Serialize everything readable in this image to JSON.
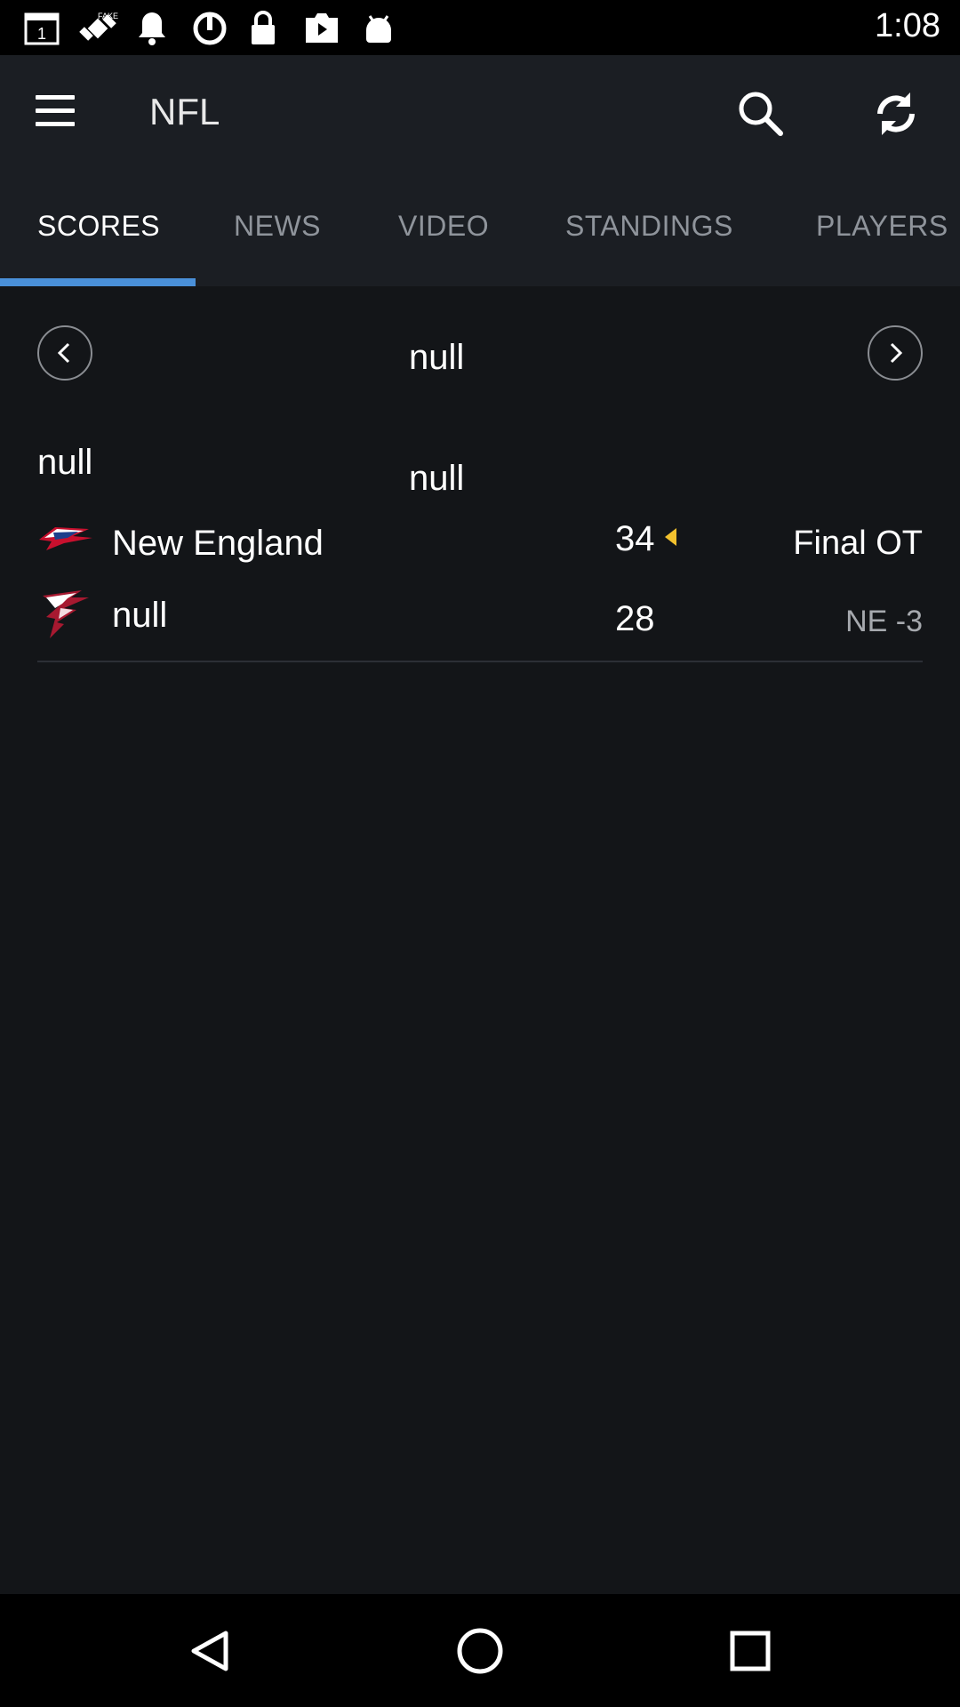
{
  "status_bar": {
    "time": "1:08",
    "icons": [
      "calendar-icon",
      "fake-gps-icon",
      "alarm-icon",
      "sync-icon",
      "lock-icon",
      "play-store-icon",
      "android-icon"
    ]
  },
  "app_bar": {
    "title": "NFL",
    "menu_icon": "hamburger-menu-icon",
    "search_icon": "search-icon",
    "refresh_icon": "refresh-icon"
  },
  "tabs": [
    {
      "label": "SCORES",
      "active": true
    },
    {
      "label": "NEWS",
      "active": false
    },
    {
      "label": "VIDEO",
      "active": false
    },
    {
      "label": "STANDINGS",
      "active": false
    },
    {
      "label": "PLAYERS",
      "active": false
    }
  ],
  "date_nav": {
    "label": "null",
    "prev_icon": "chevron-left-icon",
    "next_icon": "chevron-right-icon"
  },
  "game_group": {
    "left_label": "null",
    "center_label": "null"
  },
  "game": {
    "teams": [
      {
        "name": "New England",
        "score": "34",
        "logo": "patriots-logo-icon",
        "winner": true
      },
      {
        "name": "null",
        "score": "28",
        "logo": "falcons-logo-icon",
        "winner": false
      }
    ],
    "status": "Final OT",
    "line": "NE -3",
    "colors": {
      "winner_arrow": "#f2c12e",
      "tab_accent": "#4a90d9"
    }
  },
  "nav_bar": {
    "icons": [
      "back-triangle-icon",
      "home-circle-icon",
      "recents-square-icon"
    ]
  }
}
